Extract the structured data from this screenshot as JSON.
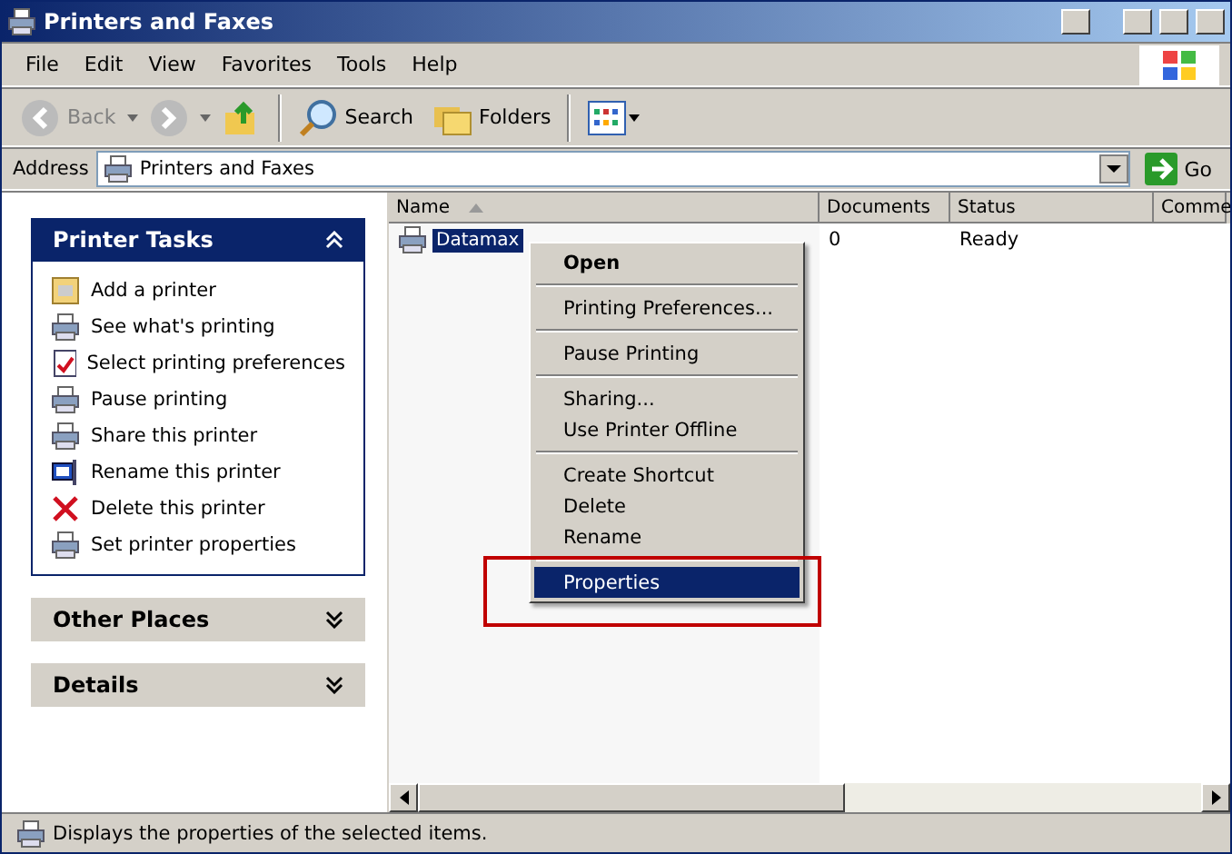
{
  "window": {
    "title": "Printers and Faxes"
  },
  "menu_bar": [
    "File",
    "Edit",
    "View",
    "Favorites",
    "Tools",
    "Help"
  ],
  "toolbar": [
    {
      "kind": "back",
      "label": "Back",
      "disabled": true
    },
    {
      "kind": "forward",
      "disabled": true
    },
    {
      "kind": "up"
    },
    {
      "kind": "search",
      "label": "Search"
    },
    {
      "kind": "folders",
      "label": "Folders"
    },
    {
      "kind": "views"
    }
  ],
  "address": {
    "label": "Address",
    "value": "Printers and Faxes",
    "go": "Go"
  },
  "sidebar": [
    {
      "title": "Printer Tasks",
      "expanded": true,
      "items": [
        {
          "label": "Add a printer"
        },
        {
          "label": "See what's printing"
        },
        {
          "label": "Select printing preferences"
        },
        {
          "label": "Pause printing"
        },
        {
          "label": "Share this printer"
        },
        {
          "label": "Rename this printer"
        },
        {
          "label": "Delete this printer"
        },
        {
          "label": "Set printer properties"
        }
      ]
    },
    {
      "title": "Other Places",
      "expanded": false
    },
    {
      "title": "Details",
      "expanded": false
    }
  ],
  "table": {
    "columns": [
      "Name",
      "Documents",
      "Status",
      "Comme"
    ],
    "rows": [
      {
        "selected": true,
        "cells": [
          "Datamax",
          "0",
          "Ready",
          ""
        ]
      }
    ]
  },
  "context_menu": [
    {
      "kind": "item",
      "label": "Open",
      "default": true,
      "selected": false
    },
    {
      "kind": "separator"
    },
    {
      "kind": "item",
      "label": "Printing Preferences...",
      "default": false,
      "selected": false
    },
    {
      "kind": "separator"
    },
    {
      "kind": "item",
      "label": "Pause Printing",
      "default": false,
      "selected": false
    },
    {
      "kind": "separator"
    },
    {
      "kind": "item",
      "label": "Sharing...",
      "default": false,
      "selected": false
    },
    {
      "kind": "item",
      "label": "Use Printer Offline",
      "default": false,
      "selected": false
    },
    {
      "kind": "separator"
    },
    {
      "kind": "item",
      "label": "Create Shortcut",
      "default": false,
      "selected": false
    },
    {
      "kind": "item",
      "label": "Delete",
      "default": false,
      "selected": false
    },
    {
      "kind": "item",
      "label": "Rename",
      "default": false,
      "selected": false
    },
    {
      "kind": "separator"
    },
    {
      "kind": "item",
      "label": "Properties",
      "default": false,
      "selected": true
    }
  ],
  "status_bar": "Displays the properties of the selected items."
}
